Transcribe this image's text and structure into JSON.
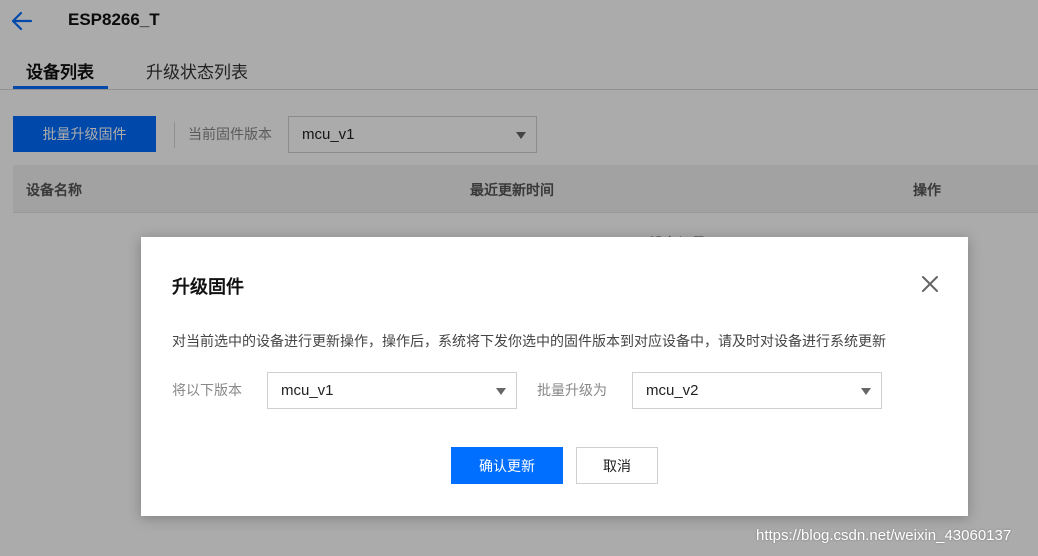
{
  "header": {
    "title": "ESP8266_T",
    "back_icon": "arrow-left-icon"
  },
  "tabs": [
    {
      "label": "设备列表",
      "active": true
    },
    {
      "label": "升级状态列表",
      "active": false
    }
  ],
  "toolbar": {
    "batch_button": "批量升级固件",
    "fw_label": "当前固件版本",
    "fw_select_value": "mcu_v1"
  },
  "table": {
    "columns": [
      "设备名称",
      "最近更新时间",
      "操作"
    ],
    "partial_row_text": "没有记录"
  },
  "modal": {
    "title": "升级固件",
    "close_icon": "close-icon",
    "description": "对当前选中的设备进行更新操作，操作后，系统将下发你选中的固件版本到对应设备中，请及时对设备进行系统更新",
    "from_label": "将以下版本",
    "from_value": "mcu_v1",
    "to_label": "批量升级为",
    "to_value": "mcu_v2",
    "confirm_button": "确认更新",
    "cancel_button": "取消"
  },
  "watermark": "https://blog.csdn.net/weixin_43060137",
  "colors": {
    "accent": "#006eff",
    "overlay": "rgba(0,0,0,0.33)"
  }
}
